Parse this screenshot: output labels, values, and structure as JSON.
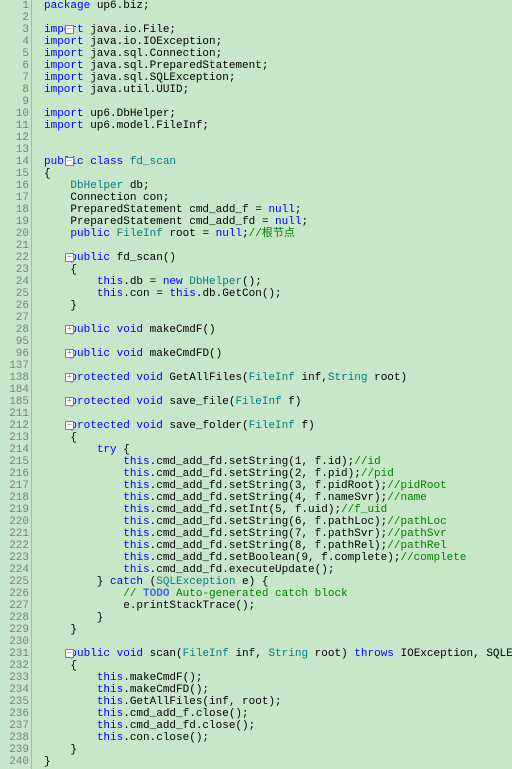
{
  "lines": [
    {
      "n": 1,
      "t": [
        {
          "c": "kw",
          "v": "package"
        },
        {
          "v": " up6.biz;"
        }
      ]
    },
    {
      "n": 2,
      "t": []
    },
    {
      "n": 3,
      "f": "-",
      "t": [
        {
          "c": "kw",
          "v": "import"
        },
        {
          "v": " java.io.File;"
        }
      ]
    },
    {
      "n": 4,
      "t": [
        {
          "c": "kw",
          "v": "import"
        },
        {
          "v": " java.io.IOException;"
        }
      ]
    },
    {
      "n": 5,
      "t": [
        {
          "c": "kw",
          "v": "import"
        },
        {
          "v": " java.sql.Connection;"
        }
      ]
    },
    {
      "n": 6,
      "t": [
        {
          "c": "kw",
          "v": "import"
        },
        {
          "v": " java.sql.PreparedStatement;"
        }
      ]
    },
    {
      "n": 7,
      "t": [
        {
          "c": "kw",
          "v": "import"
        },
        {
          "v": " java.sql.SQLException;"
        }
      ]
    },
    {
      "n": 8,
      "t": [
        {
          "c": "kw",
          "v": "import"
        },
        {
          "v": " java.util.UUID;"
        }
      ]
    },
    {
      "n": 9,
      "t": []
    },
    {
      "n": 10,
      "t": [
        {
          "c": "kw",
          "v": "import"
        },
        {
          "v": " up6.DbHelper;"
        }
      ]
    },
    {
      "n": 11,
      "t": [
        {
          "c": "kw",
          "v": "import"
        },
        {
          "v": " up6.model.FileInf;"
        }
      ]
    },
    {
      "n": 12,
      "t": []
    },
    {
      "n": 13,
      "t": []
    },
    {
      "n": 14,
      "f": "-",
      "t": [
        {
          "c": "kw",
          "v": "public class "
        },
        {
          "c": "cls",
          "v": "fd_scan"
        }
      ]
    },
    {
      "n": 15,
      "t": [
        {
          "v": "{"
        }
      ]
    },
    {
      "n": 16,
      "t": [
        {
          "v": "    "
        },
        {
          "c": "cls",
          "v": "DbHelper"
        },
        {
          "v": " db;"
        }
      ]
    },
    {
      "n": 17,
      "t": [
        {
          "v": "    Connection con;"
        }
      ]
    },
    {
      "n": 18,
      "t": [
        {
          "v": "    PreparedStatement cmd_add_f = "
        },
        {
          "c": "kw",
          "v": "null"
        },
        {
          "v": ";"
        }
      ]
    },
    {
      "n": 19,
      "t": [
        {
          "v": "    PreparedStatement cmd_add_fd = "
        },
        {
          "c": "kw",
          "v": "null"
        },
        {
          "v": ";"
        }
      ]
    },
    {
      "n": 20,
      "t": [
        {
          "v": "    "
        },
        {
          "c": "kw",
          "v": "public "
        },
        {
          "c": "cls",
          "v": "FileInf"
        },
        {
          "v": " root = "
        },
        {
          "c": "kw",
          "v": "null"
        },
        {
          "v": ";"
        },
        {
          "c": "cmt",
          "v": "//根节点"
        }
      ]
    },
    {
      "n": 21,
      "t": []
    },
    {
      "n": 22,
      "f": "-",
      "t": [
        {
          "v": "    "
        },
        {
          "c": "kw",
          "v": "public"
        },
        {
          "v": " fd_scan()"
        }
      ]
    },
    {
      "n": 23,
      "t": [
        {
          "v": "    {"
        }
      ]
    },
    {
      "n": 24,
      "t": [
        {
          "v": "        "
        },
        {
          "c": "kw",
          "v": "this"
        },
        {
          "v": ".db = "
        },
        {
          "c": "kw",
          "v": "new "
        },
        {
          "c": "cls",
          "v": "DbHelper"
        },
        {
          "v": "();"
        }
      ]
    },
    {
      "n": 25,
      "t": [
        {
          "v": "        "
        },
        {
          "c": "kw",
          "v": "this"
        },
        {
          "v": ".con = "
        },
        {
          "c": "kw",
          "v": "this"
        },
        {
          "v": ".db.GetCon();"
        }
      ]
    },
    {
      "n": 26,
      "t": [
        {
          "v": "    }"
        }
      ]
    },
    {
      "n": 27,
      "t": []
    },
    {
      "n": 28,
      "f": "+",
      "t": [
        {
          "v": "    "
        },
        {
          "c": "kw",
          "v": "public void"
        },
        {
          "v": " makeCmdF()"
        }
      ]
    },
    {
      "n": 95,
      "t": []
    },
    {
      "n": 96,
      "f": "+",
      "t": [
        {
          "v": "    "
        },
        {
          "c": "kw",
          "v": "public void"
        },
        {
          "v": " makeCmdFD()"
        }
      ]
    },
    {
      "n": 137,
      "t": []
    },
    {
      "n": 138,
      "f": "+",
      "t": [
        {
          "v": "    "
        },
        {
          "c": "kw",
          "v": "protected void"
        },
        {
          "v": " GetAllFiles("
        },
        {
          "c": "cls",
          "v": "FileInf"
        },
        {
          "v": " inf,"
        },
        {
          "c": "cls",
          "v": "String"
        },
        {
          "v": " root)"
        }
      ]
    },
    {
      "n": 184,
      "t": []
    },
    {
      "n": 185,
      "f": "+",
      "t": [
        {
          "v": "    "
        },
        {
          "c": "kw",
          "v": "protected void"
        },
        {
          "v": " save_file("
        },
        {
          "c": "cls",
          "v": "FileInf"
        },
        {
          "v": " f)"
        }
      ]
    },
    {
      "n": 211,
      "t": []
    },
    {
      "n": 212,
      "f": "-",
      "t": [
        {
          "v": "    "
        },
        {
          "c": "kw",
          "v": "protected void"
        },
        {
          "v": " save_folder("
        },
        {
          "c": "cls",
          "v": "FileInf"
        },
        {
          "v": " f)"
        }
      ]
    },
    {
      "n": 213,
      "t": [
        {
          "v": "    {"
        }
      ]
    },
    {
      "n": 214,
      "t": [
        {
          "v": "        "
        },
        {
          "c": "kw",
          "v": "try"
        },
        {
          "v": " {"
        }
      ]
    },
    {
      "n": 215,
      "t": [
        {
          "v": "            "
        },
        {
          "c": "kw",
          "v": "this"
        },
        {
          "v": ".cmd_add_fd.setString(1, f.id);"
        },
        {
          "c": "cmt",
          "v": "//id"
        }
      ]
    },
    {
      "n": 216,
      "t": [
        {
          "v": "            "
        },
        {
          "c": "kw",
          "v": "this"
        },
        {
          "v": ".cmd_add_fd.setString(2, f.pid);"
        },
        {
          "c": "cmt",
          "v": "//pid"
        }
      ]
    },
    {
      "n": 217,
      "t": [
        {
          "v": "            "
        },
        {
          "c": "kw",
          "v": "this"
        },
        {
          "v": ".cmd_add_fd.setString(3, f.pidRoot);"
        },
        {
          "c": "cmt",
          "v": "//pidRoot"
        }
      ]
    },
    {
      "n": 218,
      "t": [
        {
          "v": "            "
        },
        {
          "c": "kw",
          "v": "this"
        },
        {
          "v": ".cmd_add_fd.setString(4, f.nameSvr);"
        },
        {
          "c": "cmt",
          "v": "//name"
        }
      ]
    },
    {
      "n": 219,
      "t": [
        {
          "v": "            "
        },
        {
          "c": "kw",
          "v": "this"
        },
        {
          "v": ".cmd_add_fd.setInt(5, f.uid);"
        },
        {
          "c": "cmt",
          "v": "//f_uid"
        }
      ]
    },
    {
      "n": 220,
      "t": [
        {
          "v": "            "
        },
        {
          "c": "kw",
          "v": "this"
        },
        {
          "v": ".cmd_add_fd.setString(6, f.pathLoc);"
        },
        {
          "c": "cmt",
          "v": "//pathLoc"
        }
      ]
    },
    {
      "n": 221,
      "t": [
        {
          "v": "            "
        },
        {
          "c": "kw",
          "v": "this"
        },
        {
          "v": ".cmd_add_fd.setString(7, f.pathSvr);"
        },
        {
          "c": "cmt",
          "v": "//pathSvr"
        }
      ]
    },
    {
      "n": 222,
      "t": [
        {
          "v": "            "
        },
        {
          "c": "kw",
          "v": "this"
        },
        {
          "v": ".cmd_add_fd.setString(8, f.pathRel);"
        },
        {
          "c": "cmt",
          "v": "//pathRel"
        }
      ]
    },
    {
      "n": 223,
      "t": [
        {
          "v": "            "
        },
        {
          "c": "kw",
          "v": "this"
        },
        {
          "v": ".cmd_add_fd.setBoolean(9, f.complete);"
        },
        {
          "c": "cmt",
          "v": "//complete"
        }
      ]
    },
    {
      "n": 224,
      "t": [
        {
          "v": "            "
        },
        {
          "c": "kw",
          "v": "this"
        },
        {
          "v": ".cmd_add_fd.executeUpdate();"
        }
      ]
    },
    {
      "n": 225,
      "t": [
        {
          "v": "        } "
        },
        {
          "c": "kw",
          "v": "catch"
        },
        {
          "v": " ("
        },
        {
          "c": "cls",
          "v": "SQLException"
        },
        {
          "v": " e) {"
        }
      ]
    },
    {
      "n": 226,
      "t": [
        {
          "v": "            "
        },
        {
          "c": "cmt",
          "v": "// "
        },
        {
          "c": "todo",
          "v": "TODO"
        },
        {
          "c": "cmt",
          "v": " Auto-generated catch block"
        }
      ]
    },
    {
      "n": 227,
      "t": [
        {
          "v": "            e.printStackTrace();"
        }
      ]
    },
    {
      "n": 228,
      "t": [
        {
          "v": "        }"
        }
      ]
    },
    {
      "n": 229,
      "t": [
        {
          "v": "    }"
        }
      ]
    },
    {
      "n": 230,
      "t": []
    },
    {
      "n": 231,
      "f": "-",
      "t": [
        {
          "v": "    "
        },
        {
          "c": "kw",
          "v": "public void"
        },
        {
          "v": " scan("
        },
        {
          "c": "cls",
          "v": "FileInf"
        },
        {
          "v": " inf, "
        },
        {
          "c": "cls",
          "v": "String"
        },
        {
          "v": " root) "
        },
        {
          "c": "kw",
          "v": "throws"
        },
        {
          "v": " IOException, SQLException"
        }
      ]
    },
    {
      "n": 232,
      "t": [
        {
          "v": "    {"
        }
      ]
    },
    {
      "n": 233,
      "t": [
        {
          "v": "        "
        },
        {
          "c": "kw",
          "v": "this"
        },
        {
          "v": ".makeCmdF();"
        }
      ]
    },
    {
      "n": 234,
      "t": [
        {
          "v": "        "
        },
        {
          "c": "kw",
          "v": "this"
        },
        {
          "v": ".makeCmdFD();"
        }
      ]
    },
    {
      "n": 235,
      "t": [
        {
          "v": "        "
        },
        {
          "c": "kw",
          "v": "this"
        },
        {
          "v": ".GetAllFiles(inf, root);"
        }
      ]
    },
    {
      "n": 236,
      "t": [
        {
          "v": "        "
        },
        {
          "c": "kw",
          "v": "this"
        },
        {
          "v": ".cmd_add_f.close();"
        }
      ]
    },
    {
      "n": 237,
      "t": [
        {
          "v": "        "
        },
        {
          "c": "kw",
          "v": "this"
        },
        {
          "v": ".cmd_add_fd.close();"
        }
      ]
    },
    {
      "n": 238,
      "t": [
        {
          "v": "        "
        },
        {
          "c": "kw",
          "v": "this"
        },
        {
          "v": ".con.close();"
        }
      ]
    },
    {
      "n": 239,
      "t": [
        {
          "v": "    }"
        }
      ]
    },
    {
      "n": 240,
      "t": [
        {
          "v": "}"
        }
      ]
    }
  ]
}
